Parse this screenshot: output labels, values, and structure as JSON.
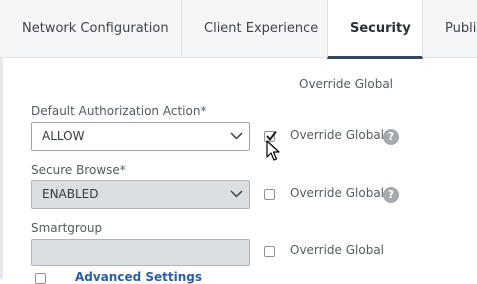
{
  "tabs": [
    {
      "label": "Network Configuration"
    },
    {
      "label": "Client Experience"
    },
    {
      "label": "Security"
    },
    {
      "label": "Publis"
    }
  ],
  "column_header": "Override Global",
  "fields": [
    {
      "label": "Default Authorization Action*",
      "value": "ALLOW",
      "override_label": "Override Global",
      "override_checked": true,
      "help": "?"
    },
    {
      "label": "Secure Browse*",
      "value": "ENABLED",
      "override_label": "Override Global",
      "override_checked": false,
      "help": "?"
    },
    {
      "label": "Smartgroup",
      "value": "",
      "override_label": "Override Global",
      "override_checked": false
    }
  ],
  "advanced": {
    "label": "Advanced Settings"
  }
}
